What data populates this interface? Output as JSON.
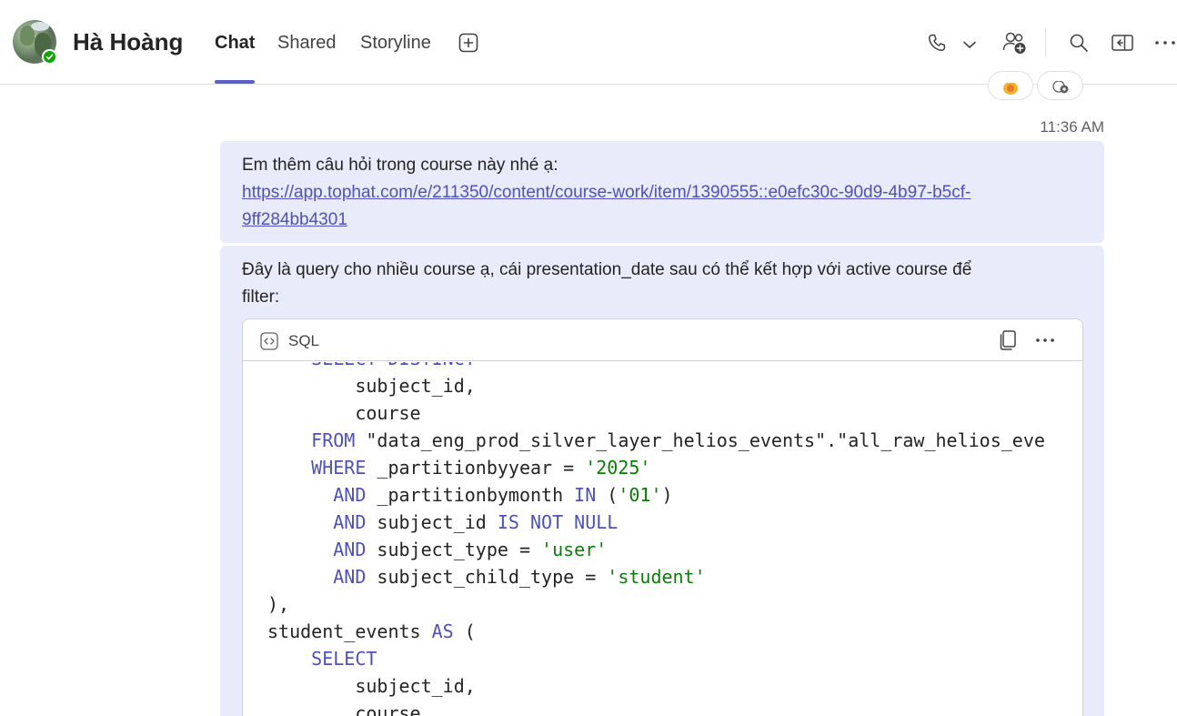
{
  "header": {
    "contact_name": "Hà Hoàng",
    "tabs": [
      {
        "label": "Chat",
        "active": true
      },
      {
        "label": "Shared",
        "active": false
      },
      {
        "label": "Storyline",
        "active": false
      }
    ],
    "add_tab_icon": "plus-square-icon",
    "actions": [
      "phone-icon",
      "chevron-down-icon",
      "add-people-icon",
      "search-icon",
      "side-panel-icon",
      "more-icon"
    ]
  },
  "presence_status": "available",
  "colors": {
    "accent": "#5b5fc7",
    "bubble_bg": "#e8ebfa",
    "keyword": "#4f52b2",
    "string": "#0e7a0d",
    "presence": "#13a10e"
  },
  "messages": {
    "timestamp": "11:36 AM",
    "msg1": {
      "text": "Em thêm câu hỏi trong course này nhé ạ:",
      "link_line1": "https://app.tophat.com/e/211350/content/course-work/item/1390555::e0efc30c-90d9-4b97-b5cf-",
      "link_line2": "9ff284bb4301"
    },
    "msg2": {
      "text_line1": " Đây là query cho nhiều course ạ, cái presentation_date sau có thể kết hợp với active course để",
      "text_line2": "filter:",
      "code": {
        "language": "SQL",
        "lines": [
          [
            {
              "t": "    "
            },
            {
              "t": "SELECT DISTINCT",
              "c": "kw"
            }
          ],
          [
            {
              "t": "        subject_id,"
            }
          ],
          [
            {
              "t": "        course"
            }
          ],
          [
            {
              "t": "    "
            },
            {
              "t": "FROM",
              "c": "kw"
            },
            {
              "t": " \"data_eng_prod_silver_layer_helios_events\".\"all_raw_helios_eve"
            }
          ],
          [
            {
              "t": "    "
            },
            {
              "t": "WHERE",
              "c": "kw"
            },
            {
              "t": " _partitionbyyear = "
            },
            {
              "t": "'2025'",
              "c": "str"
            }
          ],
          [
            {
              "t": "      "
            },
            {
              "t": "AND",
              "c": "kw"
            },
            {
              "t": " _partitionbymonth "
            },
            {
              "t": "IN",
              "c": "kw"
            },
            {
              "t": " ("
            },
            {
              "t": "'01'",
              "c": "str"
            },
            {
              "t": ")"
            }
          ],
          [
            {
              "t": "      "
            },
            {
              "t": "AND",
              "c": "kw"
            },
            {
              "t": " subject_id "
            },
            {
              "t": "IS NOT NULL",
              "c": "kw"
            }
          ],
          [
            {
              "t": "      "
            },
            {
              "t": "AND",
              "c": "kw"
            },
            {
              "t": " subject_type = "
            },
            {
              "t": "'user'",
              "c": "str"
            }
          ],
          [
            {
              "t": "      "
            },
            {
              "t": "AND",
              "c": "kw"
            },
            {
              "t": " subject_child_type = "
            },
            {
              "t": "'student'",
              "c": "str"
            }
          ],
          [
            {
              "t": "),"
            }
          ],
          [
            {
              "t": "student_events "
            },
            {
              "t": "AS",
              "c": "kw"
            },
            {
              "t": " ("
            }
          ],
          [
            {
              "t": "    "
            },
            {
              "t": "SELECT",
              "c": "kw"
            }
          ],
          [
            {
              "t": "        subject_id,"
            }
          ],
          [
            {
              "t": "        course"
            }
          ]
        ]
      }
    }
  }
}
